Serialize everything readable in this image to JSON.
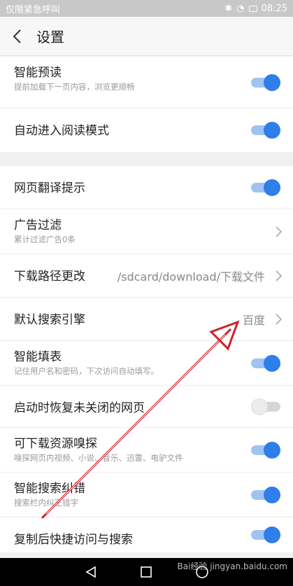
{
  "status": {
    "left": "仅限紧急呼叫",
    "time": "08:25"
  },
  "header": {
    "title": "设置"
  },
  "section1": [
    {
      "label": "智能预读",
      "sub": "提前加载下一页内容，浏览更顺畅",
      "switch": "on"
    },
    {
      "label": "自动进入阅读模式",
      "switch": "on"
    }
  ],
  "section2": [
    {
      "label": "网页翻译提示",
      "switch": "on"
    },
    {
      "label": "广告过滤",
      "sub": "累计过滤广告0条",
      "chevron": true
    },
    {
      "label": "下载路径更改",
      "value": "/sdcard/download/下载文件",
      "chevron": true
    },
    {
      "label": "默认搜索引擎",
      "value": "百度",
      "chevron": true
    },
    {
      "label": "智能填表",
      "sub": "记住用户名和密码，下次访问自动填写。",
      "switch": "on"
    },
    {
      "label": "启动时恢复未关闭的网页",
      "switch": "off"
    },
    {
      "label": "可下载资源嗅探",
      "sub": "嗅探网页内视频、小说、音乐、迅雷、电驴文件",
      "switch": "on"
    },
    {
      "label": "智能搜索纠错",
      "sub": "搜索栏内纠正错字",
      "switch": "on"
    },
    {
      "label": "复制后快捷访问与搜索",
      "switch": "on"
    }
  ],
  "watermark": "Bai经验 jingyan.baidu.com",
  "colors": {
    "accent": "#2f7ee9",
    "arrow": "#d0202a"
  }
}
